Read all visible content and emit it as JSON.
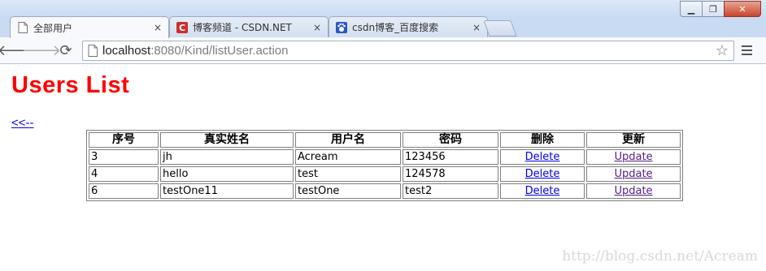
{
  "browser": {
    "tabs": [
      {
        "title": "全部用户",
        "active": true,
        "icon": "page-icon"
      },
      {
        "title": "博客频道 - CSDN.NET",
        "active": false,
        "icon": "csdn-logo-icon"
      },
      {
        "title": "csdn博客_百度搜索",
        "active": false,
        "icon": "baidu-paw-icon"
      }
    ],
    "close_glyph": "×",
    "url_host": "localhost",
    "url_rest": ":8080/Kind/listUser.action"
  },
  "page": {
    "heading": "Users List",
    "back_link": "<<--"
  },
  "table": {
    "headers": [
      "序号",
      "真实姓名",
      "用户名",
      "密码",
      "删除",
      "更新"
    ],
    "rows": [
      {
        "id": "3",
        "realname": "jh",
        "username": "Acream",
        "password": "123456",
        "delete": "Delete",
        "update": "Update"
      },
      {
        "id": "4",
        "realname": "hello",
        "username": "test",
        "password": "124578",
        "delete": "Delete",
        "update": "Update"
      },
      {
        "id": "6",
        "realname": "testOne11",
        "username": "testOne",
        "password": "test2",
        "delete": "Delete",
        "update": "Update"
      }
    ]
  },
  "watermark": "http://blog.csdn.net/Acream",
  "colors": {
    "heading": "#ff0000",
    "link": "#0000ee",
    "visited_link": "#551a8b"
  }
}
